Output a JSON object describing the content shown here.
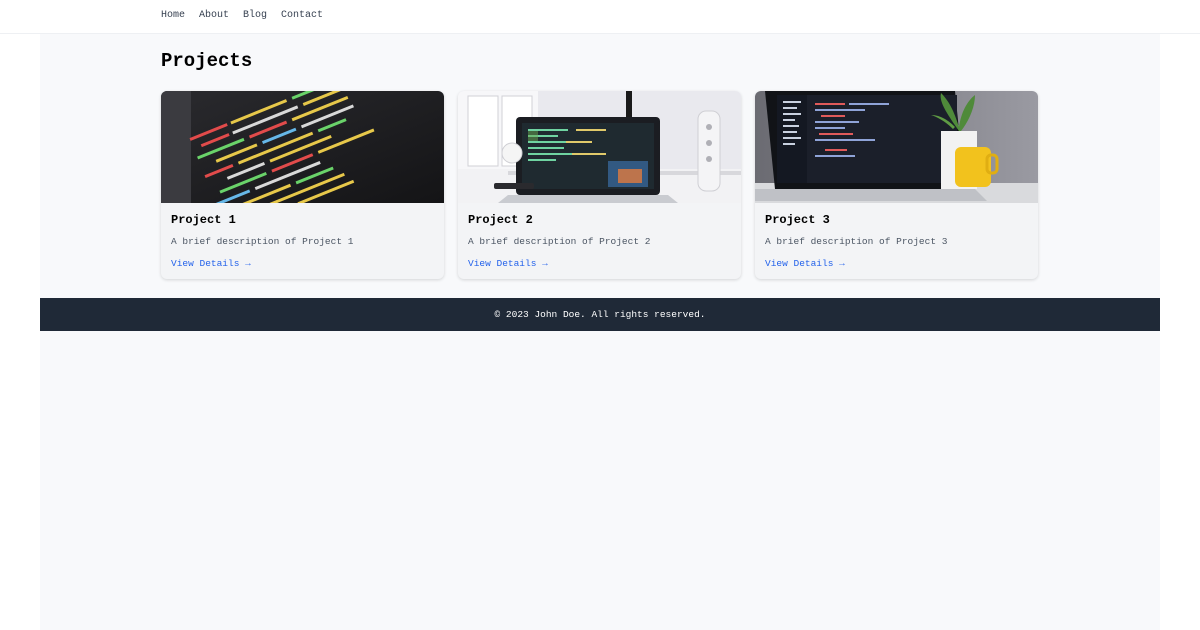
{
  "nav": {
    "items": [
      "Home",
      "About",
      "Blog",
      "Contact"
    ]
  },
  "main": {
    "title": "Projects",
    "projects": [
      {
        "title": "Project 1",
        "description": "A brief description of Project 1",
        "link": "View Details →",
        "image": "code-closeup-photo"
      },
      {
        "title": "Project 2",
        "description": "A brief description of Project 2",
        "link": "View Details →",
        "image": "laptop-desk-photo"
      },
      {
        "title": "Project 3",
        "description": "A brief description of Project 3",
        "link": "View Details →",
        "image": "laptop-plant-photo"
      }
    ]
  },
  "footer": {
    "text": "© 2023 John Doe. All rights reserved."
  },
  "colors": {
    "accent": "#2563eb",
    "footer_bg": "#1f2937",
    "page_bg": "#f8f9fb",
    "card_bg": "#f3f4f6"
  }
}
